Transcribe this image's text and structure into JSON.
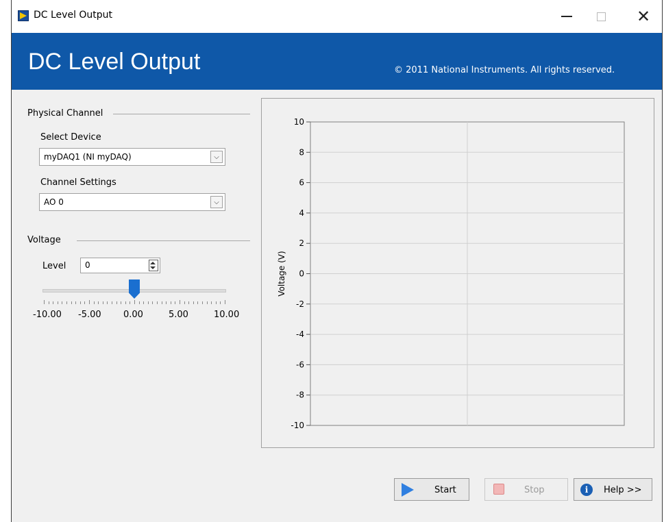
{
  "window": {
    "title": "DC Level Output",
    "controls": {
      "minimize": "—",
      "maximize": "☐",
      "close": "✕"
    }
  },
  "header": {
    "title": "DC Level Output",
    "copyright": "© 2011 National Instruments. All rights reserved."
  },
  "physical_channel": {
    "section_label": "Physical Channel",
    "device_label": "Select Device",
    "device_value": "myDAQ1 (NI myDAQ)",
    "channel_label": "Channel Settings",
    "channel_value": "AO 0"
  },
  "voltage": {
    "section_label": "Voltage",
    "level_label": "Level",
    "level_value": "0",
    "slider": {
      "min": -10,
      "max": 10,
      "value": 0,
      "tick_labels": [
        "-10.00",
        "-5.00",
        "0.00",
        "5.00",
        "10.00"
      ]
    }
  },
  "buttons": {
    "start": "Start",
    "stop": "Stop",
    "help": "Help >>"
  },
  "chart_data": {
    "type": "line",
    "title": "",
    "xlabel": "",
    "ylabel": "Voltage (V)",
    "ylim": [
      -10,
      10
    ],
    "y_ticks": [
      10,
      8,
      6,
      4,
      2,
      0,
      -2,
      -4,
      -6,
      -8,
      -10
    ],
    "grid": true,
    "series": []
  },
  "colors": {
    "header_bg": "#0f58a8",
    "slider_thumb": "#1a6fd0",
    "start_icon": "#2f7fe0",
    "info_icon": "#1a5fb4"
  }
}
